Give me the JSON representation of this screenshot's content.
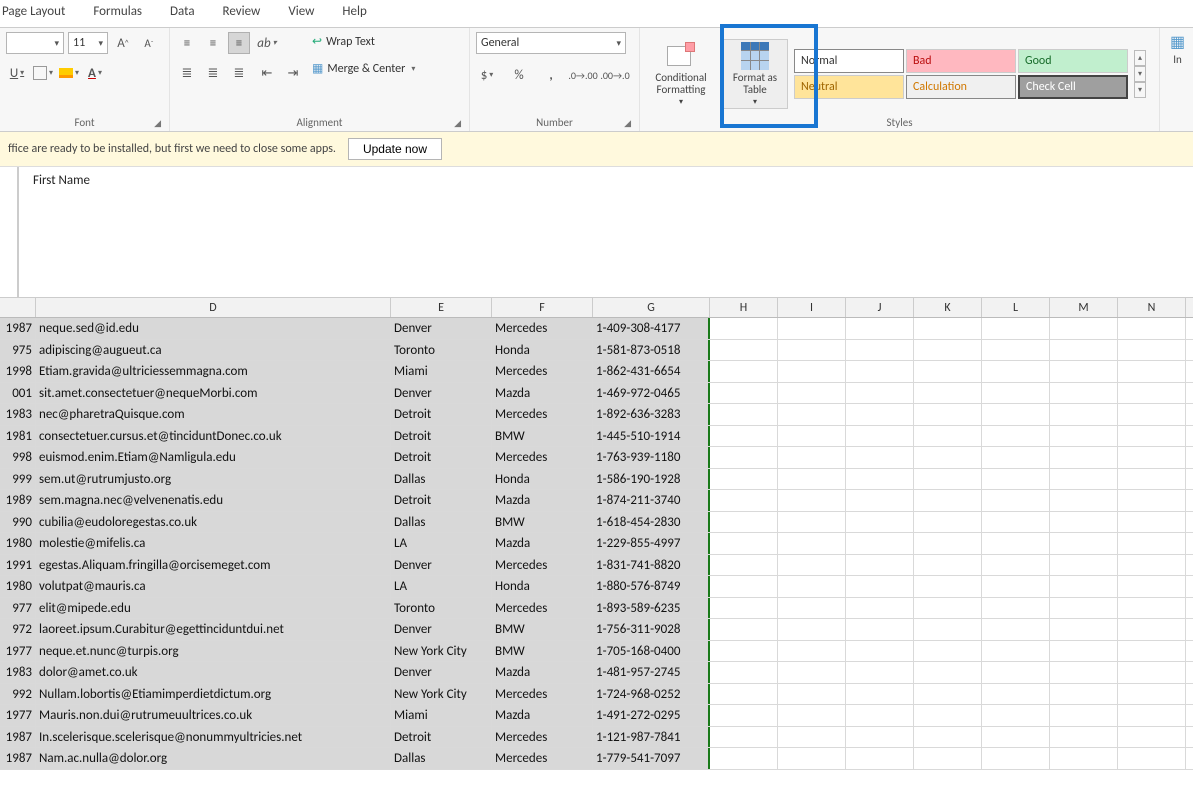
{
  "menu": {
    "tabs": [
      "Page Layout",
      "Formulas",
      "Data",
      "Review",
      "View",
      "Help"
    ]
  },
  "ribbon": {
    "font": {
      "size": "11",
      "group_label": "Font"
    },
    "alignment": {
      "wrap_text": "Wrap Text",
      "merge_center": "Merge & Center",
      "group_label": "Alignment"
    },
    "number": {
      "format": "General",
      "group_label": "Number"
    },
    "styles": {
      "conditional_formatting": "Conditional\nFormatting",
      "format_as_table": "Format as\nTable",
      "cells": {
        "normal": "Normal",
        "bad": "Bad",
        "good": "Good",
        "neutral": "Neutral",
        "calculation": "Calculation",
        "check_cell": "Check Cell"
      },
      "group_label": "Styles"
    },
    "insert_label": "In"
  },
  "msgbar": {
    "text": "ffice are ready to be installed, but first we need to close some apps.",
    "button": "Update now"
  },
  "formula_bar": {
    "value": "First Name"
  },
  "columns": [
    {
      "key": "c",
      "label": "",
      "w": "w-c"
    },
    {
      "key": "d",
      "label": "D",
      "w": "w-d"
    },
    {
      "key": "e",
      "label": "E",
      "w": "w-e"
    },
    {
      "key": "f",
      "label": "F",
      "w": "w-f"
    },
    {
      "key": "g",
      "label": "G",
      "w": "w-g"
    },
    {
      "key": "h",
      "label": "H",
      "w": "w-oth"
    },
    {
      "key": "i",
      "label": "I",
      "w": "w-oth"
    },
    {
      "key": "j",
      "label": "J",
      "w": "w-oth"
    },
    {
      "key": "k",
      "label": "K",
      "w": "w-oth"
    },
    {
      "key": "l",
      "label": "L",
      "w": "w-oth"
    },
    {
      "key": "m",
      "label": "M",
      "w": "w-oth"
    },
    {
      "key": "n",
      "label": "N",
      "w": "w-oth"
    }
  ],
  "rows": [
    {
      "c": "1987",
      "d": "neque.sed@id.edu",
      "e": "Denver",
      "f": "Mercedes",
      "g": "1-409-308-4177"
    },
    {
      "c": "975",
      "d": "adipiscing@augueut.ca",
      "e": "Toronto",
      "f": "Honda",
      "g": "1-581-873-0518"
    },
    {
      "c": "1998",
      "d": "Etiam.gravida@ultriciessemmagna.com",
      "e": "Miami",
      "f": "Mercedes",
      "g": "1-862-431-6654"
    },
    {
      "c": "001",
      "d": "sit.amet.consectetuer@nequeMorbi.com",
      "e": "Denver",
      "f": "Mazda",
      "g": "1-469-972-0465"
    },
    {
      "c": "1983",
      "d": "nec@pharetraQuisque.com",
      "e": "Detroit",
      "f": "Mercedes",
      "g": "1-892-636-3283"
    },
    {
      "c": "1981",
      "d": "consectetuer.cursus.et@tinciduntDonec.co.uk",
      "e": "Detroit",
      "f": "BMW",
      "g": "1-445-510-1914"
    },
    {
      "c": "998",
      "d": "euismod.enim.Etiam@Namligula.edu",
      "e": "Detroit",
      "f": "Mercedes",
      "g": "1-763-939-1180"
    },
    {
      "c": "999",
      "d": "sem.ut@rutrumjusto.org",
      "e": "Dallas",
      "f": "Honda",
      "g": "1-586-190-1928"
    },
    {
      "c": "1989",
      "d": "sem.magna.nec@velvenenatis.edu",
      "e": "Detroit",
      "f": "Mazda",
      "g": "1-874-211-3740"
    },
    {
      "c": "990",
      "d": "cubilia@eudoloregestas.co.uk",
      "e": "Dallas",
      "f": "BMW",
      "g": "1-618-454-2830"
    },
    {
      "c": "1980",
      "d": "molestie@mifelis.ca",
      "e": "LA",
      "f": "Mazda",
      "g": "1-229-855-4997"
    },
    {
      "c": "1991",
      "d": "egestas.Aliquam.fringilla@orcisemeget.com",
      "e": "Denver",
      "f": "Mercedes",
      "g": "1-831-741-8820"
    },
    {
      "c": "1980",
      "d": "volutpat@mauris.ca",
      "e": "LA",
      "f": "Honda",
      "g": "1-880-576-8749"
    },
    {
      "c": "977",
      "d": "elit@mipede.edu",
      "e": "Toronto",
      "f": "Mercedes",
      "g": "1-893-589-6235"
    },
    {
      "c": "972",
      "d": "laoreet.ipsum.Curabitur@egettinciduntdui.net",
      "e": "Denver",
      "f": "BMW",
      "g": "1-756-311-9028"
    },
    {
      "c": "1977",
      "d": "neque.et.nunc@turpis.org",
      "e": "New York City",
      "f": "BMW",
      "g": "1-705-168-0400"
    },
    {
      "c": "1983",
      "d": "dolor@amet.co.uk",
      "e": "Denver",
      "f": "Mazda",
      "g": "1-481-957-2745"
    },
    {
      "c": "992",
      "d": "Nullam.lobortis@Etiamimperdietdictum.org",
      "e": "New York City",
      "f": "Mercedes",
      "g": "1-724-968-0252"
    },
    {
      "c": "1977",
      "d": "Mauris.non.dui@rutrumeuultrices.co.uk",
      "e": "Miami",
      "f": "Mazda",
      "g": "1-491-272-0295"
    },
    {
      "c": "1987",
      "d": "In.scelerisque.scelerisque@nonummyultricies.net",
      "e": "Detroit",
      "f": "Mercedes",
      "g": "1-121-987-7841"
    },
    {
      "c": "1987",
      "d": "Nam.ac.nulla@dolor.org",
      "e": "Dallas",
      "f": "Mercedes",
      "g": "1-779-541-7097"
    }
  ]
}
